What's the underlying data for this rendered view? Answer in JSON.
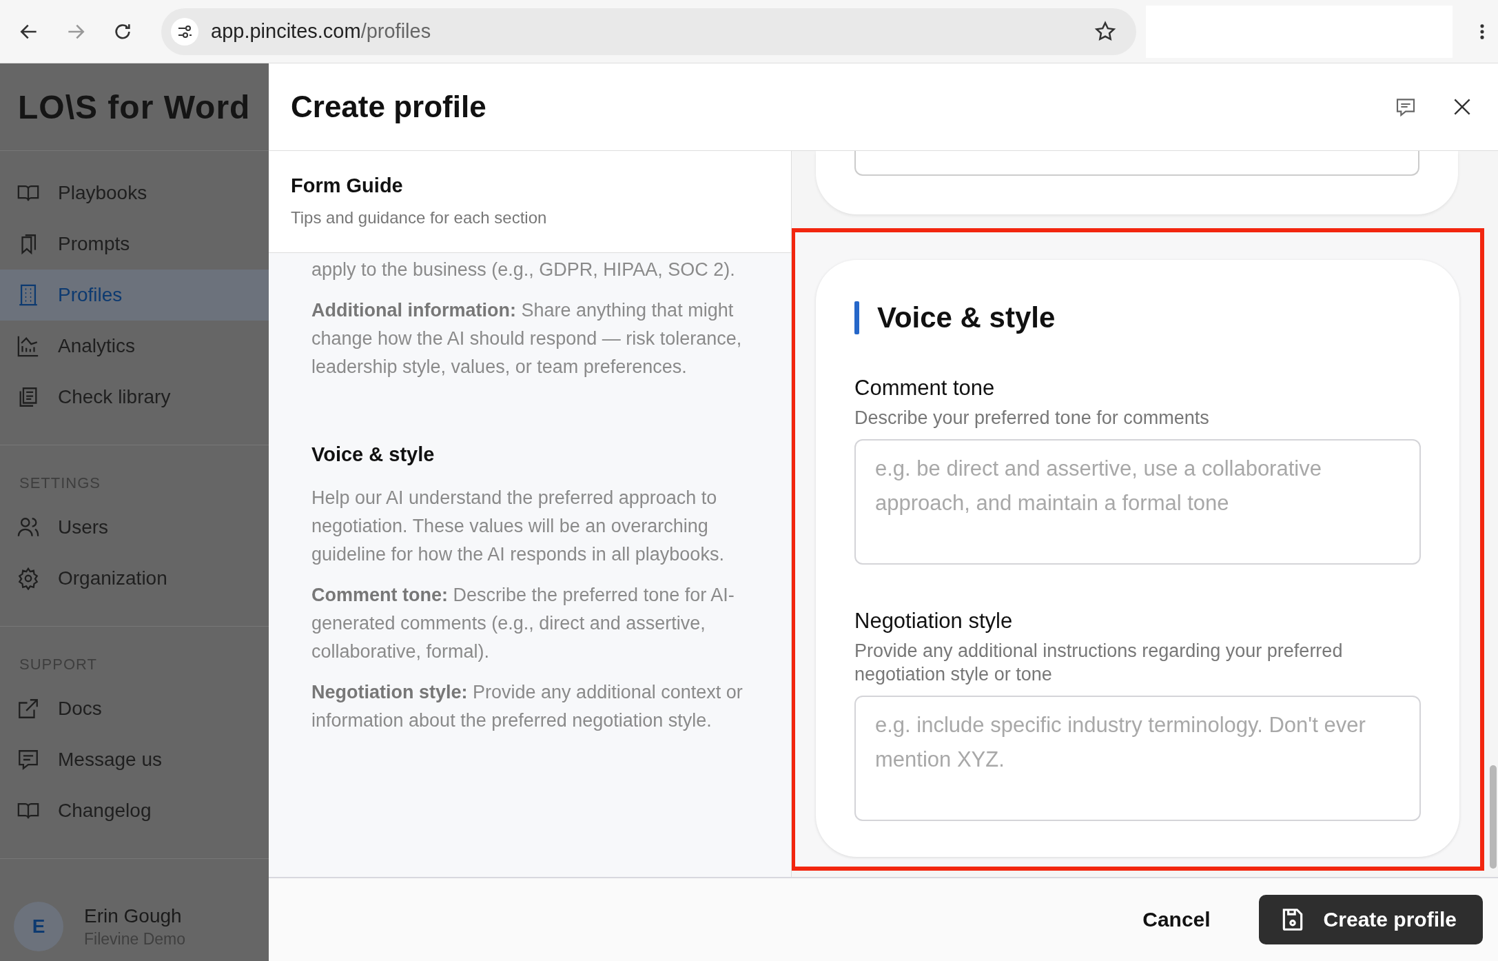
{
  "browser": {
    "url_host": "app.pincites.com",
    "url_path": "/profiles"
  },
  "sidebar": {
    "logo": "LO\\S for Word",
    "sections": [
      {
        "items": [
          {
            "label": "Playbooks",
            "selected": false
          },
          {
            "label": "Prompts",
            "selected": false
          },
          {
            "label": "Profiles",
            "selected": true
          },
          {
            "label": "Analytics",
            "selected": false
          },
          {
            "label": "Check library",
            "selected": false
          }
        ]
      },
      {
        "heading": "SETTINGS",
        "items": [
          {
            "label": "Users",
            "selected": false
          },
          {
            "label": "Organization",
            "selected": false
          }
        ]
      },
      {
        "heading": "SUPPORT",
        "items": [
          {
            "label": "Docs",
            "selected": false
          },
          {
            "label": "Message us",
            "selected": false
          },
          {
            "label": "Changelog",
            "selected": false
          }
        ]
      }
    ],
    "user": {
      "initial": "E",
      "name": "Erin Gough",
      "org": "Filevine Demo"
    }
  },
  "modal": {
    "title": "Create profile",
    "guide": {
      "title": "Form Guide",
      "subtitle": "Tips and guidance for each section",
      "blocks": [
        {
          "kind": "para",
          "text": "apply to the business (e.g., GDPR, HIPAA, SOC 2)."
        },
        {
          "kind": "para",
          "text": "**Additional information:** Share anything that might change how the AI should respond — risk tolerance, leadership style, values, or team preferences."
        },
        {
          "kind": "heading",
          "text": "Voice & style"
        },
        {
          "kind": "para",
          "text": "Help our AI understand the preferred approach to negotiation. These values will be an overarching guideline for how the AI responds in all playbooks."
        },
        {
          "kind": "para",
          "text": "**Comment tone:** Describe the preferred tone for AI-generated comments (e.g., direct and assertive, collaborative, formal)."
        },
        {
          "kind": "para",
          "text": "**Negotiation style:** Provide any additional context or information about the preferred negotiation style."
        }
      ]
    },
    "form": {
      "section_title": "Voice & style",
      "fields": [
        {
          "label": "Comment tone",
          "hint": "Describe your preferred tone for comments",
          "placeholder": "e.g. be direct and assertive, use a collaborative approach, and maintain a formal tone"
        },
        {
          "label": "Negotiation style",
          "hint": "Provide any additional instructions regarding your preferred negotiation style or tone",
          "placeholder": "e.g. include specific industry terminology. Don't ever mention XYZ."
        }
      ]
    },
    "cancel": "Cancel",
    "submit": "Create profile"
  }
}
